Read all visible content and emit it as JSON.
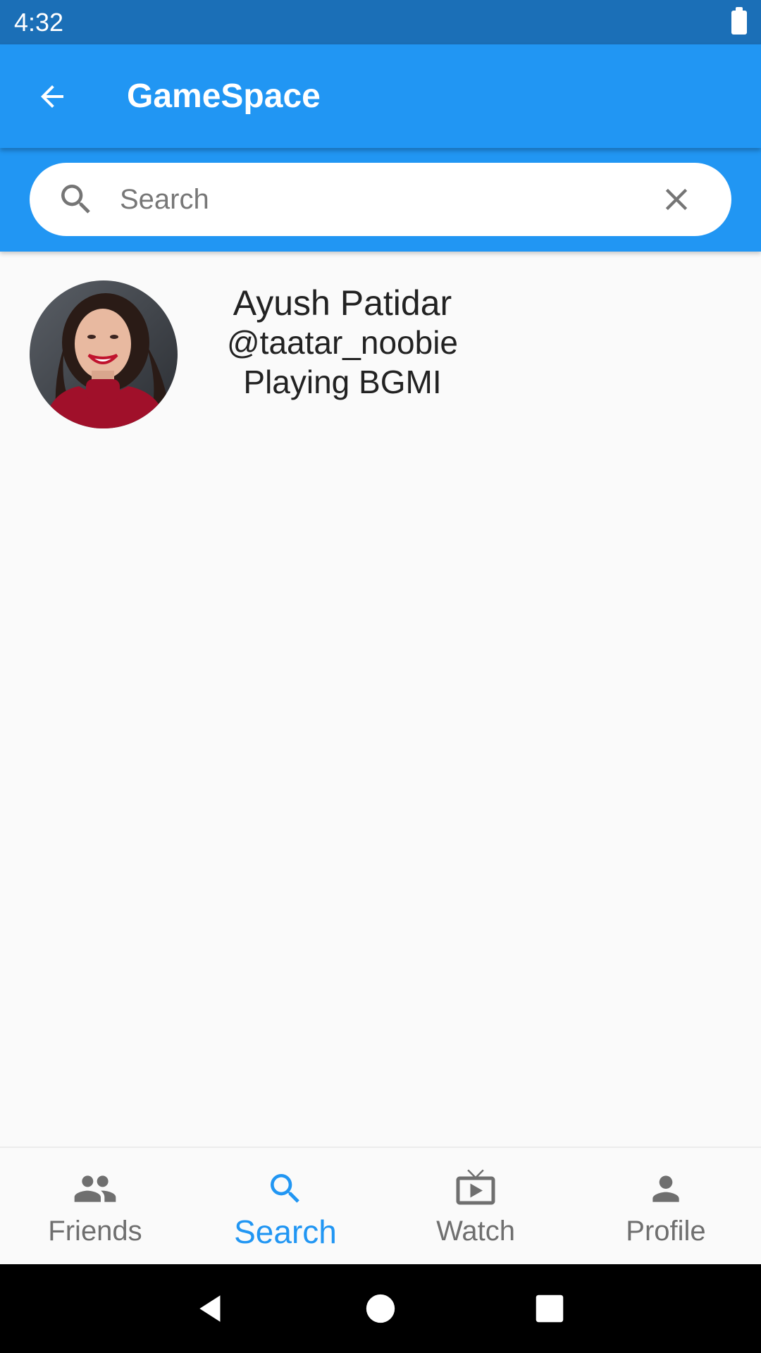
{
  "status_bar": {
    "time": "4:32"
  },
  "app_bar": {
    "title": "GameSpace",
    "back_icon": "arrow-back-icon"
  },
  "search": {
    "placeholder": "Search",
    "value": "",
    "search_icon": "search-icon",
    "clear_icon": "close-icon"
  },
  "results": [
    {
      "name": "Ayush Patidar",
      "handle": "@taatar_noobie",
      "status": "Playing BGMI"
    }
  ],
  "bottom_nav": {
    "active": "Search",
    "active_color": "#2196f3",
    "items": [
      {
        "label": "Friends",
        "icon": "people-icon"
      },
      {
        "label": "Search",
        "icon": "search-icon"
      },
      {
        "label": "Watch",
        "icon": "tv-icon"
      },
      {
        "label": "Profile",
        "icon": "person-icon"
      }
    ]
  },
  "colors": {
    "primary": "#2196f3",
    "status_bar": "#1b6fb7",
    "background": "#fafafa"
  }
}
